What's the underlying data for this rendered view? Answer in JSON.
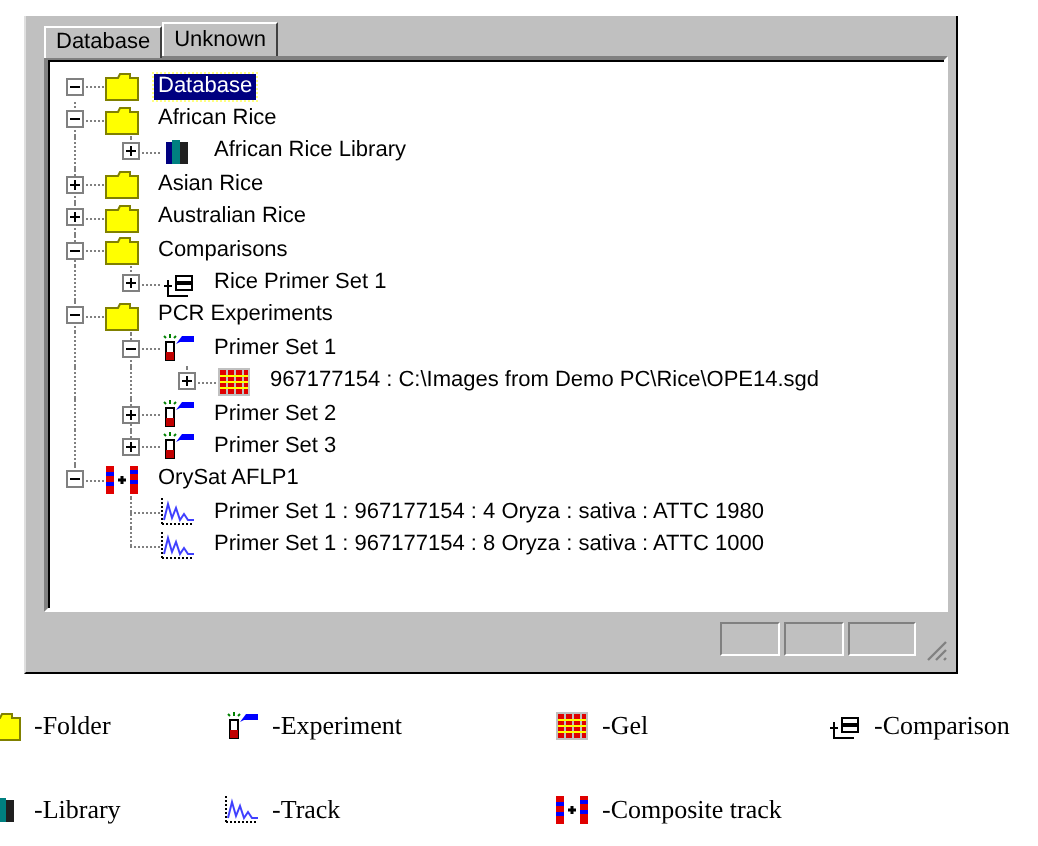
{
  "tabs": [
    {
      "label": "Database",
      "selected": true
    },
    {
      "label": "Unknown",
      "selected": false
    }
  ],
  "tree": [
    {
      "kind": "folder",
      "label": "Database",
      "selected": true,
      "expanded": true,
      "children": [
        {
          "kind": "folder",
          "label": "African Rice",
          "selected": false,
          "expanded": true,
          "children": [
            {
              "kind": "library",
              "label": "African Rice Library",
              "selected": false,
              "expanded": false
            }
          ]
        },
        {
          "kind": "folder",
          "label": "Asian Rice",
          "selected": false,
          "expanded": false
        },
        {
          "kind": "folder",
          "label": "Australian Rice",
          "selected": false,
          "expanded": false
        },
        {
          "kind": "folder",
          "label": "Comparisons",
          "selected": false,
          "expanded": true,
          "children": [
            {
              "kind": "comparison",
              "label": "Rice Primer Set 1",
              "selected": false,
              "expanded": false
            }
          ]
        },
        {
          "kind": "folder",
          "label": "PCR Experiments",
          "selected": false,
          "expanded": true,
          "children": [
            {
              "kind": "experiment",
              "label": "Primer Set 1",
              "selected": false,
              "expanded": true,
              "children": [
                {
                  "kind": "gel",
                  "label": "967177154 : C:\\Images from Demo PC\\Rice\\OPE14.sgd",
                  "selected": false,
                  "expanded": false
                }
              ]
            },
            {
              "kind": "experiment",
              "label": "Primer Set 2",
              "selected": false,
              "expanded": false
            },
            {
              "kind": "experiment",
              "label": "Primer Set 3",
              "selected": false,
              "expanded": false
            }
          ]
        },
        {
          "kind": "composite",
          "label": "OrySat AFLP1",
          "selected": false,
          "expanded": true,
          "children": [
            {
              "kind": "track",
              "label": "Primer Set 1 : 967177154 : 4 Oryza : sativa : ATTC 1980",
              "selected": false
            },
            {
              "kind": "track",
              "label": "Primer Set 1 : 967177154 : 8 Oryza : sativa : ATTC 1000",
              "selected": false
            }
          ]
        }
      ]
    }
  ],
  "legend": [
    {
      "kind": "folder",
      "label": "-Folder"
    },
    {
      "kind": "experiment",
      "label": "-Experiment"
    },
    {
      "kind": "gel",
      "label": "-Gel"
    },
    {
      "kind": "comparison",
      "label": "-Comparison"
    },
    {
      "kind": "library",
      "label": "-Library"
    },
    {
      "kind": "track",
      "label": "-Track"
    },
    {
      "kind": "composite",
      "label": "-Composite track"
    }
  ]
}
